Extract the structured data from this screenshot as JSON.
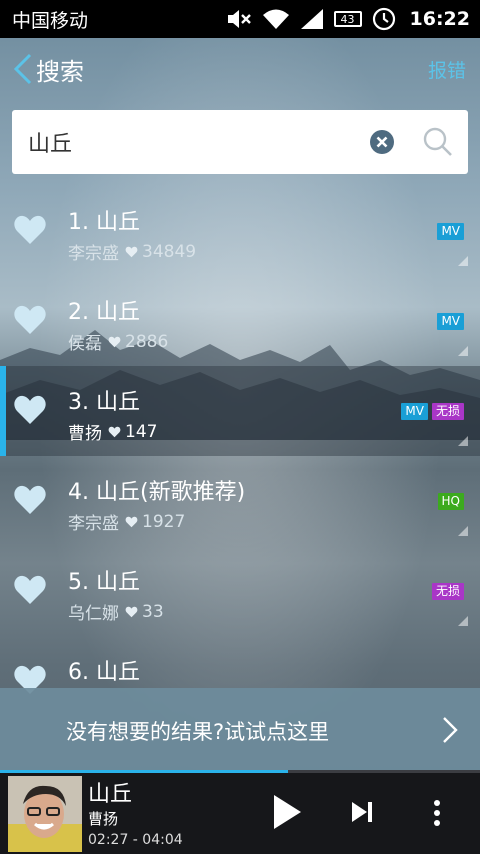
{
  "status_bar": {
    "carrier": "中国移动",
    "battery": "43",
    "time": "16:22"
  },
  "header": {
    "title": "搜索",
    "report": "报错"
  },
  "search": {
    "query": "山丘"
  },
  "results": [
    {
      "title": "1. 山丘",
      "artist": "李宗盛",
      "likes": "34849",
      "tags": [
        "MV"
      ]
    },
    {
      "title": "2. 山丘",
      "artist": "侯磊",
      "likes": "2886",
      "tags": [
        "MV"
      ]
    },
    {
      "title": "3. 山丘",
      "artist": "曹扬",
      "likes": "147",
      "tags": [
        "MV",
        "无损"
      ],
      "selected": true
    },
    {
      "title": "4. 山丘(新歌推荐)",
      "artist": "李宗盛",
      "likes": "1927",
      "tags": [
        "HQ"
      ]
    },
    {
      "title": "5. 山丘",
      "artist": "乌仁娜",
      "likes": "33",
      "tags": [
        "无损"
      ]
    },
    {
      "title": "6. 山丘",
      "artist": "",
      "likes": "",
      "tags": []
    }
  ],
  "tag_colors": {
    "MV": "#1a9fd6",
    "无损": "#a936c7",
    "HQ": "#3caa1e"
  },
  "banner": {
    "text": "没有想要的结果?试试点这里"
  },
  "player": {
    "title": "山丘",
    "artist": "曹扬",
    "time": "02:27 - 04:04",
    "progress": 0.6
  },
  "accent_color": "#2ab3ea"
}
